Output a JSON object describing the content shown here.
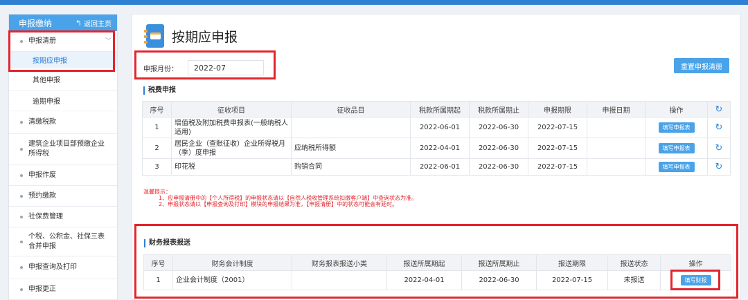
{
  "sidebar": {
    "title": "申报缴纳",
    "home_label": "返回主页",
    "items": [
      {
        "label": "申报清册"
      },
      {
        "label": "清缴税款"
      },
      {
        "label": "建筑企业项目部预缴企业所得税"
      },
      {
        "label": "申报作废"
      },
      {
        "label": "预约缴款"
      },
      {
        "label": "社保费管理"
      },
      {
        "label": "个税、公积金、社保三表合并申报"
      },
      {
        "label": "申报查询及打印"
      },
      {
        "label": "申报更正"
      }
    ],
    "sub_items": [
      {
        "label": "按期应申报"
      },
      {
        "label": "其他申报"
      },
      {
        "label": "逾期申报"
      }
    ]
  },
  "main": {
    "title": "按期应申报",
    "month_label": "申报月份：",
    "month_value": "2022-07",
    "reset_button": "重置申报清册"
  },
  "tax_section": {
    "title": "税费申报",
    "headers": [
      "序号",
      "征收项目",
      "征收品目",
      "税款所属期起",
      "税款所属期止",
      "申报期限",
      "申报日期",
      "操作"
    ],
    "rows": [
      {
        "no": "1",
        "item": "增值税及附加税费申报表(一般纳税人适用)",
        "category": "",
        "start": "2022-06-01",
        "end": "2022-06-30",
        "deadline": "2022-07-15",
        "date": "",
        "action": "填写申报表"
      },
      {
        "no": "2",
        "item": "居民企业（查账征收）企业所得税月（季）度申报",
        "category": "应纳税所得额",
        "start": "2022-04-01",
        "end": "2022-06-30",
        "deadline": "2022-07-15",
        "date": "",
        "action": "填写申报表"
      },
      {
        "no": "3",
        "item": "印花税",
        "category": "购销合同",
        "start": "2022-06-01",
        "end": "2022-06-30",
        "deadline": "2022-07-15",
        "date": "",
        "action": "填写申报表"
      }
    ]
  },
  "tips": {
    "title": "温馨提示：",
    "lines": [
      "1、应申报清册中的【个人所得税】的申报状态请以【自然人税收管理系统扣缴客户端】中查询状态为准。",
      "2、申报状态请以【申报查询及打印】模块的申报结果为准，【申报清册】中的状态可能会有延时。"
    ]
  },
  "finance_section": {
    "title": "财务报表报送",
    "headers": [
      "序号",
      "财务会计制度",
      "财务报表报送小类",
      "报送所属期起",
      "报送所属期止",
      "报送期限",
      "报送状态",
      "操作"
    ],
    "rows": [
      {
        "no": "1",
        "system": "企业会计制度（2001）",
        "subclass": "",
        "start": "2022-04-01",
        "end": "2022-06-30",
        "deadline": "2022-07-15",
        "status": "未报送",
        "action": "填写财报"
      }
    ]
  },
  "colors": {
    "accent": "#4aa3e8",
    "highlight_border": "#e2252d",
    "warning_text": "#e2252d"
  }
}
